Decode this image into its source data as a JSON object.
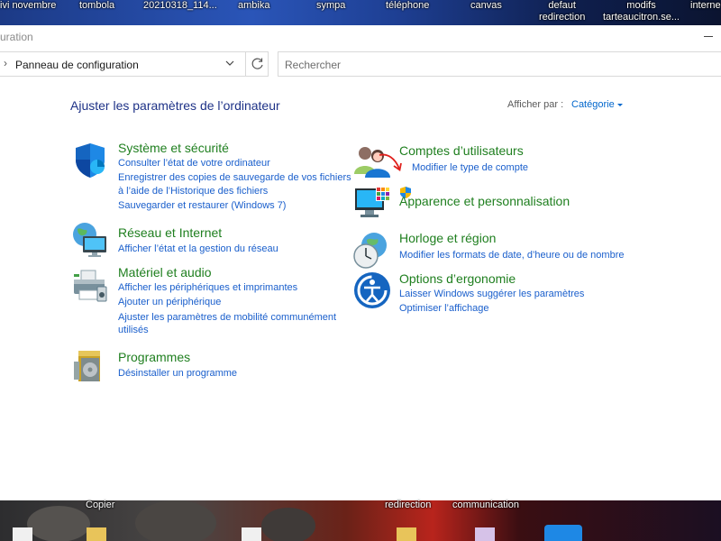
{
  "desktop_top": {
    "labels": [
      "ivi novembre",
      "tombola",
      "20210318_114...",
      "ambika",
      "sympa",
      "téléphone",
      "canvas",
      "defaut\nredirection",
      "modifs\ntarteaucitron.se...",
      "interne"
    ]
  },
  "desktop_bottom": {
    "labels": [
      "Copier",
      "redirection",
      "communication"
    ]
  },
  "window": {
    "title": "uration",
    "minimize_symbol": "—"
  },
  "addressbar": {
    "chevron": "›",
    "path": "Panneau de configuration"
  },
  "search": {
    "placeholder": "Rechercher"
  },
  "main": {
    "heading": "Ajuster les paramètres de l’ordinateur",
    "view_by_label": "Afficher par :",
    "view_by_value": "Catégorie"
  },
  "categories": {
    "system": {
      "title": "Système et sécurité",
      "links": [
        "Consulter l’état de votre ordinateur",
        "Enregistrer des copies de sauvegarde de vos fichiers",
        "à l’aide de l’Historique des fichiers",
        "Sauvegarder et restaurer (Windows 7)"
      ]
    },
    "network": {
      "title": "Réseau et Internet",
      "links": [
        "Afficher l’état et la gestion du réseau"
      ]
    },
    "hardware": {
      "title": "Matériel et audio",
      "links": [
        "Afficher les périphériques et imprimantes",
        "Ajouter un périphérique",
        "Ajuster les paramètres de mobilité communément",
        "utilisés"
      ]
    },
    "programs": {
      "title": "Programmes",
      "links": [
        "Désinstaller un programme"
      ]
    },
    "accounts": {
      "title": "Comptes d’utilisateurs",
      "links": [
        "Modifier le type de compte"
      ]
    },
    "appearance": {
      "title": "Apparence et personnalisation",
      "links": []
    },
    "clock": {
      "title": "Horloge et région",
      "links": [
        "Modifier les formats de date, d’heure ou de nombre"
      ]
    },
    "ease": {
      "title": "Options d’ergonomie",
      "links": [
        "Laisser Windows suggérer les paramètres",
        "Optimiser l’affichage"
      ]
    }
  },
  "colors": {
    "category_title": "#1f7f1f",
    "link": "#1a5fcc",
    "heading": "#1e3287",
    "annotation_arrow": "#e0201c"
  }
}
